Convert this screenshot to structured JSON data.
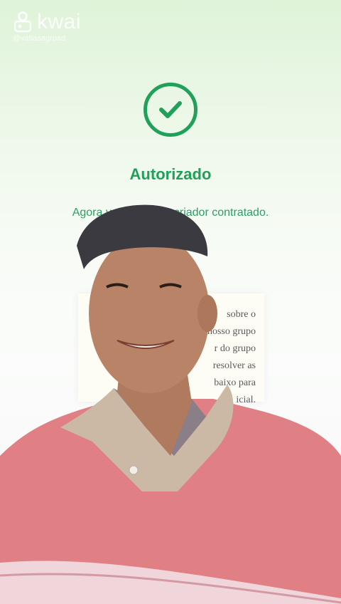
{
  "watermark": {
    "brand": "kwai",
    "handle": "@vatiasagroad"
  },
  "status": {
    "title": "Autorizado",
    "message": "Agora você tem um criador contratado."
  },
  "document_card": {
    "lines": [
      "sobre o",
      "nosso grupo",
      "r do grupo",
      "resolver as",
      "baixo para",
      "icial."
    ]
  },
  "colors": {
    "accent_green": "#21a05a",
    "shirt": "#e07f84",
    "cap": "#3a3a40"
  }
}
